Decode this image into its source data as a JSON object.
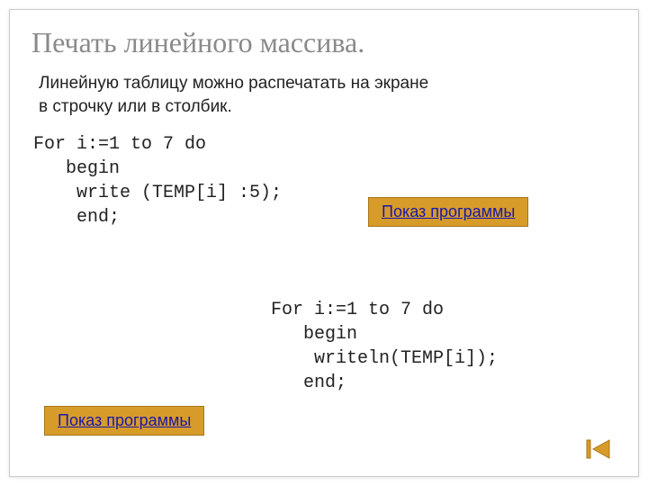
{
  "title": "Печать линейного массива.",
  "subtitle_line1": "Линейную таблицу можно распечатать на экране",
  "subtitle_line2": " в строчку или в столбик.",
  "code_block_1": "For i:=1 to 7 do\n   begin\n    write (TEMP[i] :5);\n    end;",
  "code_block_2": "For i:=1 to 7 do\n   begin\n    writeln(TEMP[i]);\n   end;",
  "button1_label": "Показ  программы",
  "button2_label": "Показ программы"
}
